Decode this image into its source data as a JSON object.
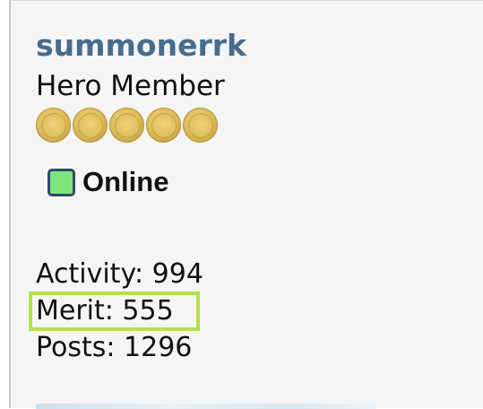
{
  "profile": {
    "username": "summonerrk",
    "rank": "Hero Member",
    "rank_star_count": 5,
    "status": {
      "icon": "online-status-icon",
      "label": "Online",
      "color": "#7ee57a"
    },
    "stats": {
      "activity_label": "Activity: 994",
      "merit_label": "Merit: 555",
      "posts_label": "Posts: 1296"
    },
    "highlight_color": "#b3e14b",
    "username_color": "#476c8e"
  }
}
